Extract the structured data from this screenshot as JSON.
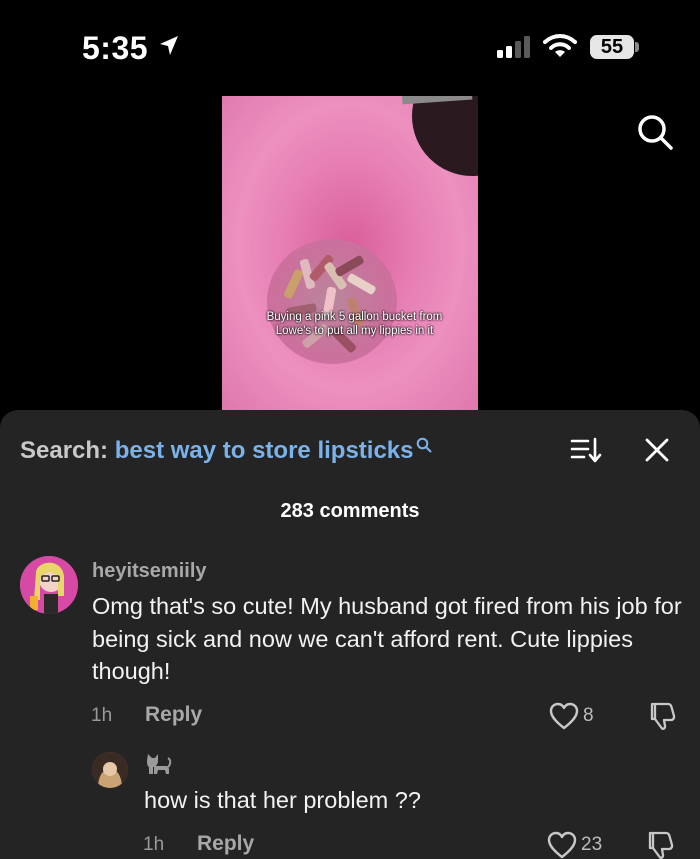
{
  "status_bar": {
    "time": "5:35",
    "battery": "55"
  },
  "video": {
    "caption": "Buying a pink 5 gallon bucket from Lowe's to put all my lippies in it"
  },
  "comments_panel": {
    "search_label": "Search:",
    "search_term": "best way to store lipsticks",
    "comment_count": "283 comments",
    "icons": [
      "search-icon",
      "sort-icon",
      "close-icon"
    ],
    "comments": [
      {
        "username": "heyitsemiily",
        "text": "Omg that's so cute! My husband got fired from his job for being sick and now we can't afford rent. Cute lippies though!",
        "time": "1h",
        "reply_label": "Reply",
        "likes": "8"
      }
    ],
    "replies": [
      {
        "username_icon": "cat-emoji-icon",
        "text": "how is that her problem ??",
        "time": "1h",
        "reply_label": "Reply",
        "likes": "23"
      }
    ]
  },
  "colors": {
    "sheet_bg": "#242424",
    "search_term": "#7cb2ea",
    "muted_text": "#a8a8a8"
  }
}
